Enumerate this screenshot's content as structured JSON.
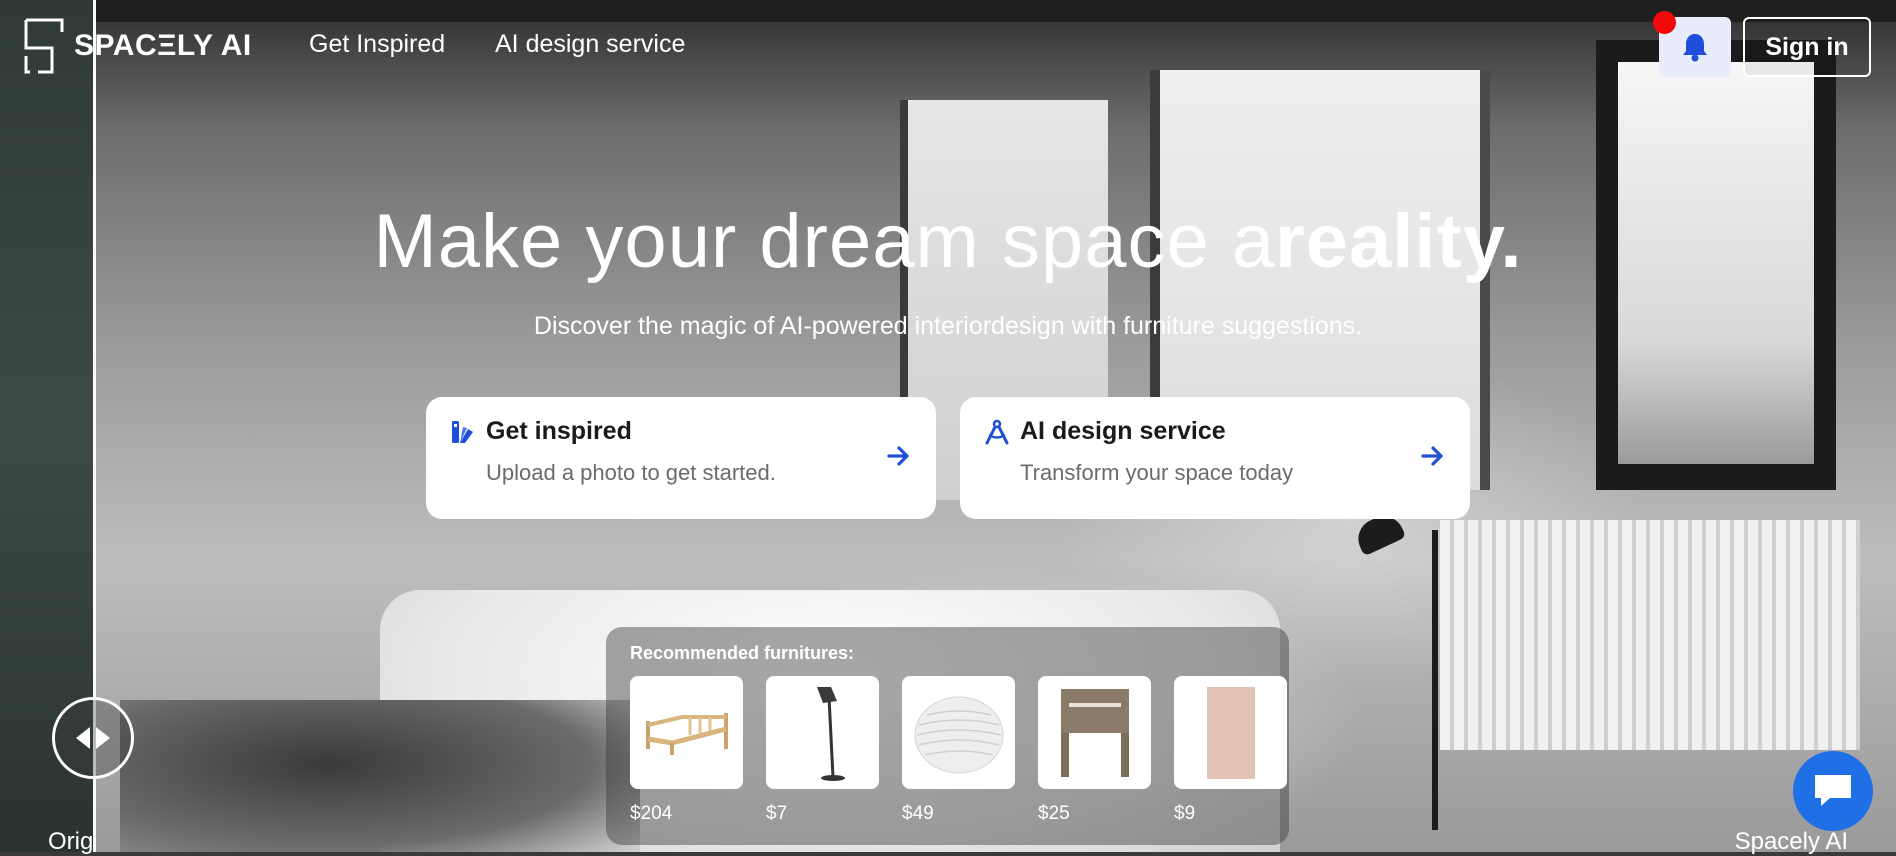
{
  "header": {
    "brand": "SPACΞLY AI",
    "nav": [
      {
        "label": "Get Inspired"
      },
      {
        "label": "AI design service"
      }
    ],
    "sign_in_label": "Sign in",
    "bell_icon": "bell-icon"
  },
  "hero": {
    "headline_regular": "Make your dream space a",
    "headline_bold": "reality.",
    "subline": "Discover the magic of AI-powered interiordesign with furniture suggestions."
  },
  "cards": [
    {
      "title": "Get inspired",
      "description": "Upload a photo to get started.",
      "icon": "palette-icon"
    },
    {
      "title": "AI design service",
      "description": "Transform your space today",
      "icon": "drafting-compass-icon"
    }
  ],
  "recommended": {
    "title": "Recommended furnitures:",
    "items": [
      {
        "price": "$204",
        "thumb": "bed-frame"
      },
      {
        "price": "$7",
        "thumb": "floor-lamp"
      },
      {
        "price": "$49",
        "thumb": "pendant-lamp"
      },
      {
        "price": "$25",
        "thumb": "headboard"
      },
      {
        "price": "$9",
        "thumb": "rug"
      }
    ]
  },
  "comparison": {
    "left_label": "Orig",
    "right_label": "Spacely AI"
  },
  "colors": {
    "accent": "#1f4fd8",
    "notification": "#f20a0a",
    "chat": "#1f6fe6"
  }
}
